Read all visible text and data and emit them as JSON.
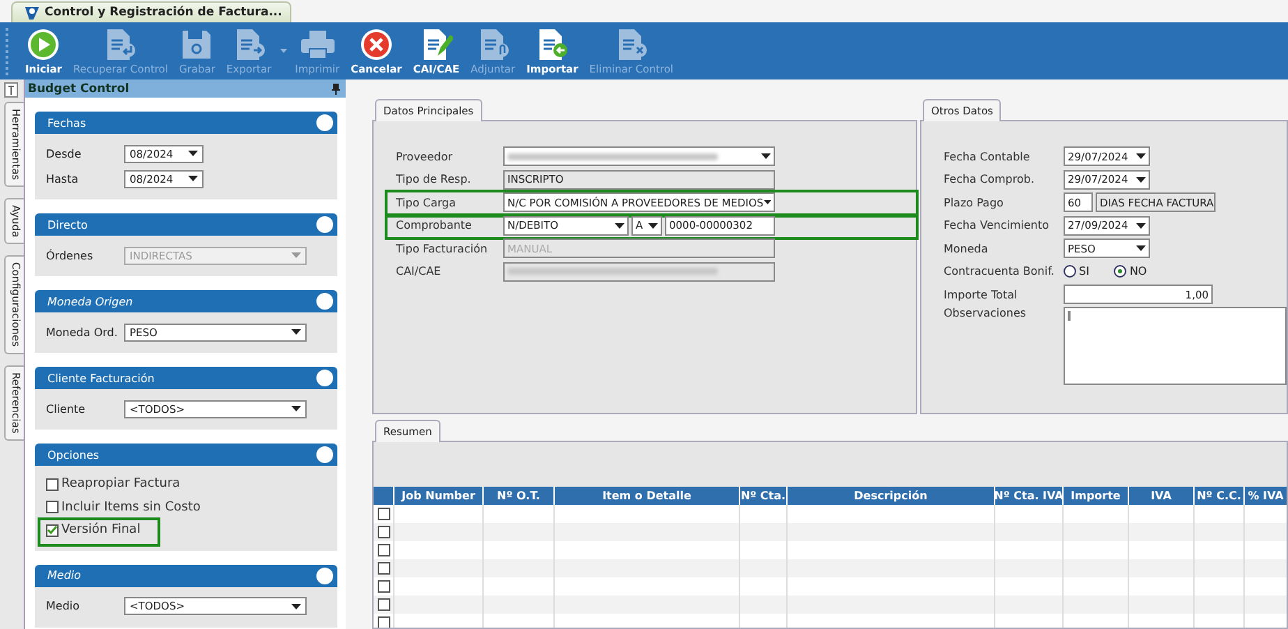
{
  "document_tab": {
    "title": "Control y Registración de Factura...",
    "selected": true
  },
  "toolbar": [
    {
      "label": "Iniciar",
      "kind": "play",
      "disabled": false
    },
    {
      "label": "Recuperar Control",
      "kind": "recover",
      "disabled": true
    },
    {
      "label": "Grabar",
      "kind": "save",
      "disabled": true
    },
    {
      "label": "Exportar",
      "kind": "export",
      "disabled": true,
      "has_menu": true
    },
    {
      "label": "Imprimir",
      "kind": "print",
      "disabled": true
    },
    {
      "label": "Cancelar",
      "kind": "cancel",
      "disabled": false
    },
    {
      "label": "CAI/CAE",
      "kind": "edit",
      "disabled": false
    },
    {
      "label": "Adjuntar",
      "kind": "attach",
      "disabled": true
    },
    {
      "label": "Importar",
      "kind": "import",
      "disabled": false
    },
    {
      "label": "Eliminar Control",
      "kind": "delete",
      "disabled": true
    }
  ],
  "side_tabs": [
    {
      "label": "Herramientas"
    },
    {
      "label": "Ayuda"
    },
    {
      "label": "Configuraciones"
    },
    {
      "label": "Referencias"
    }
  ],
  "sidebar": {
    "title": "Budget Control",
    "groups": [
      {
        "title": "Fechas",
        "italic": false,
        "fields": [
          {
            "label": "Desde",
            "kind": "period",
            "value": "08/2024",
            "disabled": false
          },
          {
            "label": "Hasta",
            "kind": "period",
            "value": "08/2024",
            "disabled": false
          }
        ]
      },
      {
        "title": "Directo",
        "italic": false,
        "fields": [
          {
            "label": "Órdenes",
            "kind": "select",
            "value": "INDIRECTAS",
            "disabled": true
          }
        ]
      },
      {
        "title": "Moneda Origen",
        "italic": true,
        "fields": [
          {
            "label": "Moneda Ord.",
            "kind": "select",
            "value": "PESO",
            "disabled": false
          }
        ]
      },
      {
        "title": "Cliente Facturación",
        "italic": false,
        "fields": [
          {
            "label": "Cliente",
            "kind": "select",
            "value": "<TODOS>",
            "disabled": false
          }
        ]
      },
      {
        "title": "Opciones",
        "italic": false,
        "options": [
          {
            "label": "Reapropiar Factura",
            "checked": false,
            "highlighted": false
          },
          {
            "label": "Incluir Items sin Costo",
            "checked": false,
            "highlighted": false
          },
          {
            "label": "Versión Final",
            "checked": true,
            "highlighted": true
          }
        ]
      },
      {
        "title": "Medio",
        "italic": true,
        "fields": [
          {
            "label": "Medio",
            "kind": "select",
            "value": "<TODOS>",
            "disabled": false
          }
        ]
      }
    ]
  },
  "datos_principales": {
    "tab": "Datos Principales",
    "rows": [
      {
        "label": "Proveedor",
        "highlighted": false,
        "fields": [
          {
            "kind": "select",
            "redacted": true
          }
        ]
      },
      {
        "label": "Tipo de Resp.",
        "highlighted": false,
        "fields": [
          {
            "kind": "text",
            "value": "INSCRIPTO",
            "readonly": true
          }
        ]
      },
      {
        "label": "Tipo Carga",
        "highlighted": true,
        "fields": [
          {
            "kind": "select",
            "value": "N/C POR COMISIÓN A PROVEEDORES DE MEDIOS"
          }
        ]
      },
      {
        "label": "Comprobante",
        "highlighted": true,
        "fields": [
          {
            "kind": "select",
            "value": "N/DEBITO"
          },
          {
            "kind": "select",
            "value": "A"
          },
          {
            "kind": "text",
            "value": "0000-00000302"
          }
        ]
      },
      {
        "label": "Tipo Facturación",
        "highlighted": false,
        "fields": [
          {
            "kind": "text",
            "value": "MANUAL",
            "readonly": true,
            "disabled": true
          }
        ]
      },
      {
        "label": "CAI/CAE",
        "highlighted": false,
        "fields": [
          {
            "kind": "text",
            "readonly": true,
            "redacted": true
          }
        ]
      }
    ]
  },
  "otros_datos": {
    "tab": "Otros Datos",
    "rows": [
      {
        "label": "Fecha Contable",
        "fields": [
          {
            "kind": "date",
            "value": "29/07/2024"
          }
        ]
      },
      {
        "label": "Fecha Comprob.",
        "fields": [
          {
            "kind": "date",
            "value": "29/07/2024"
          }
        ]
      },
      {
        "label": "Plazo Pago",
        "fields": [
          {
            "kind": "text",
            "value": "60"
          },
          {
            "kind": "text",
            "value": "DIAS FECHA FACTURA",
            "readonly": true
          }
        ]
      },
      {
        "label": "Fecha Vencimiento",
        "fields": [
          {
            "kind": "date",
            "value": "27/09/2024"
          }
        ]
      },
      {
        "label": "Moneda",
        "fields": [
          {
            "kind": "date",
            "value": "PESO"
          }
        ]
      },
      {
        "label": "Contracuenta Bonif.",
        "fields": [
          {
            "kind": "radio",
            "label": "SI",
            "selected": false
          },
          {
            "kind": "radio",
            "label": "NO",
            "selected": true
          }
        ]
      },
      {
        "label": "Importe Total",
        "fields": [
          {
            "kind": "number",
            "value": "1,00"
          }
        ]
      },
      {
        "label": "Observaciones",
        "fields": [
          {
            "kind": "textarea"
          }
        ]
      }
    ]
  },
  "resumen": {
    "tab": "Resumen",
    "columns": [
      "Job Number",
      "Nº O.T.",
      "Item o Detalle",
      "Nº Cta.",
      "Descripción",
      "Nº Cta. IVA",
      "Importe",
      "IVA",
      "Nº C.C.",
      "% IVA"
    ],
    "rows": [
      {
        "checked": false
      },
      {
        "checked": false
      },
      {
        "checked": false
      },
      {
        "checked": false
      },
      {
        "checked": false
      },
      {
        "checked": false
      },
      {
        "checked": false
      }
    ]
  }
}
